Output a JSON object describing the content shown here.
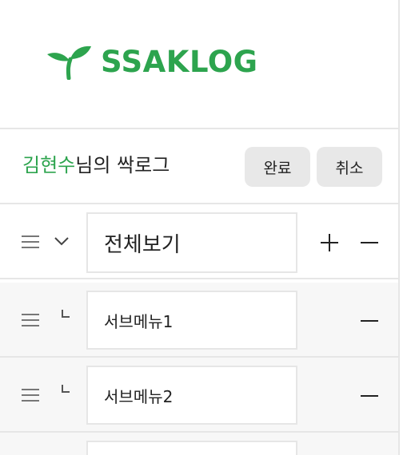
{
  "logo": {
    "text": "SSAKLOG",
    "icon": "sprout-icon",
    "color": "#2da44e"
  },
  "user_bar": {
    "user_name": "김현수",
    "suffix": "님의 싹로그",
    "done_label": "완료",
    "cancel_label": "취소"
  },
  "menu": {
    "main": {
      "value": "전체보기",
      "drag_icon": "drag-handle-icon",
      "toggle_icon": "chevron-down-icon",
      "add_icon": "plus-icon",
      "remove_icon": "minus-icon"
    },
    "submenus": [
      {
        "value": "서브메뉴1",
        "marker_icon": "sub-item-corner-icon",
        "remove_icon": "minus-icon"
      },
      {
        "value": "서브메뉴2",
        "marker_icon": "sub-item-corner-icon",
        "remove_icon": "minus-icon"
      },
      {
        "value": ""
      }
    ]
  },
  "colors": {
    "accent": "#2da44e",
    "button_bg": "#e8e8e8",
    "sub_row_bg": "#f7f7f7",
    "border": "#e6e6e6"
  }
}
